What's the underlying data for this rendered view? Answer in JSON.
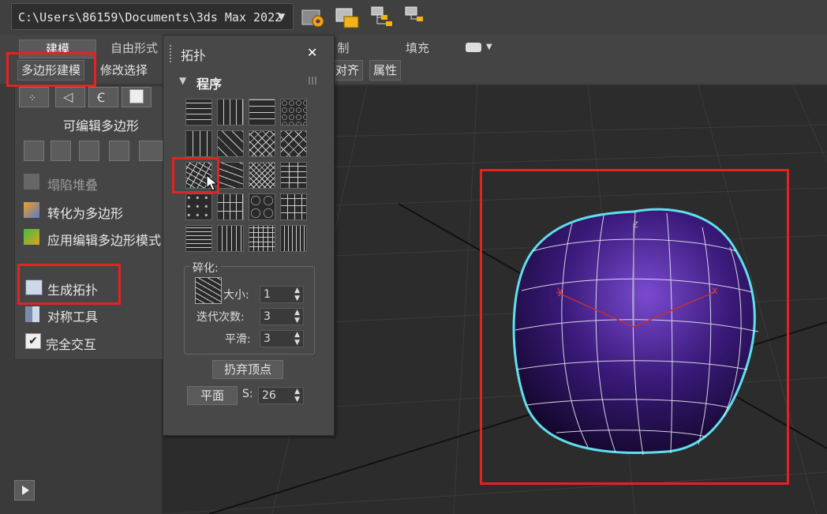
{
  "title_bar": {
    "path": "C:\\Users\\86159\\Documents\\3ds Max 2022",
    "dropdown_arrow": "▼"
  },
  "ribbon": {
    "tabs": [
      "建模",
      "自由形式",
      "控制",
      "填充"
    ],
    "tab_partial_label": "制",
    "subtabs": [
      "多边形建模",
      "修改选择",
      "对齐",
      "属性"
    ]
  },
  "left_panel": {
    "heading": "可编辑多边形",
    "items": [
      {
        "label": "塌陷堆叠",
        "icon": "collapse-stack-icon",
        "enabled": false
      },
      {
        "label": "转化为多边形",
        "icon": "convert-poly-icon",
        "enabled": true
      },
      {
        "label": "应用编辑多边形模式",
        "icon": "apply-edit-poly-icon",
        "enabled": true
      },
      {
        "label": "生成拓扑",
        "icon": "topology-icon",
        "enabled": true
      },
      {
        "label": "对称工具",
        "icon": "symmetry-icon",
        "enabled": true
      },
      {
        "label": "完全交互",
        "icon": "checkbox-icon",
        "enabled": true,
        "checked": true
      }
    ]
  },
  "topology_panel": {
    "title": "拓扑",
    "close": "✕",
    "section": "程序",
    "fracture_label": "碎化:",
    "size_label": "大小:",
    "size_value": "1",
    "iterations_label": "迭代次数:",
    "iterations_value": "3",
    "smooth_label": "平滑:",
    "smooth_value": "3",
    "discard_button": "扔弃顶点",
    "plane_button": "平面",
    "s_label": "S:",
    "s_value": "26"
  },
  "viewport": {
    "axis_x": "x",
    "axis_y": "y",
    "axis_z": "z"
  },
  "colors": {
    "highlight": "#e52222",
    "sphere": "#3a1a7a",
    "selection_outline": "#5fe0ee"
  }
}
